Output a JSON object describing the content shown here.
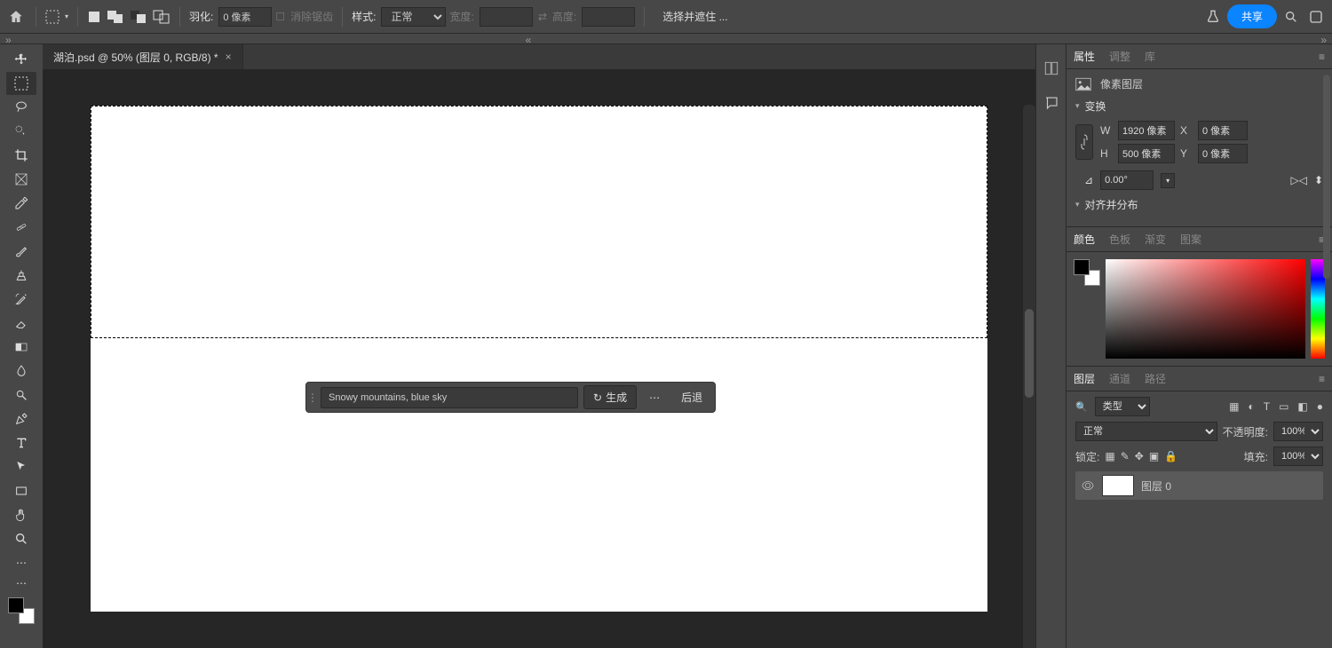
{
  "menubar": {
    "feather_label": "羽化:",
    "feather_value": "0 像素",
    "antialias_label": "消除锯齿",
    "style_label": "样式:",
    "style_value": "正常",
    "width_label": "宽度:",
    "height_label": "高度:",
    "select_mask_btn": "选择并遮住 ...",
    "share_btn": "共享"
  },
  "doc_tab": "湖泊.psd @ 50% (图层 0, RGB/8) *",
  "gen_bar": {
    "prompt_value": "Snowy mountains, blue sky",
    "generate_btn": "生成",
    "back_btn": "后退"
  },
  "panels": {
    "properties": {
      "tabs": [
        "属性",
        "调整",
        "库"
      ],
      "kind": "像素图层",
      "transform_label": "变换",
      "w_label": "W",
      "w_value": "1920 像素",
      "h_label": "H",
      "h_value": "500 像素",
      "x_label": "X",
      "x_value": "0 像素",
      "y_label": "Y",
      "y_value": "0 像素",
      "rotate_value": "0.00°",
      "align_label": "对齐并分布"
    },
    "color": {
      "tabs": [
        "颜色",
        "色板",
        "渐变",
        "图案"
      ]
    },
    "layers": {
      "tabs": [
        "图层",
        "通道",
        "路径"
      ],
      "filter_label": "类型",
      "blend_mode": "正常",
      "opacity_label": "不透明度:",
      "opacity_value": "100%",
      "lock_label": "锁定:",
      "fill_label": "填充:",
      "fill_value": "100%",
      "layer0_name": "图层 0"
    }
  }
}
